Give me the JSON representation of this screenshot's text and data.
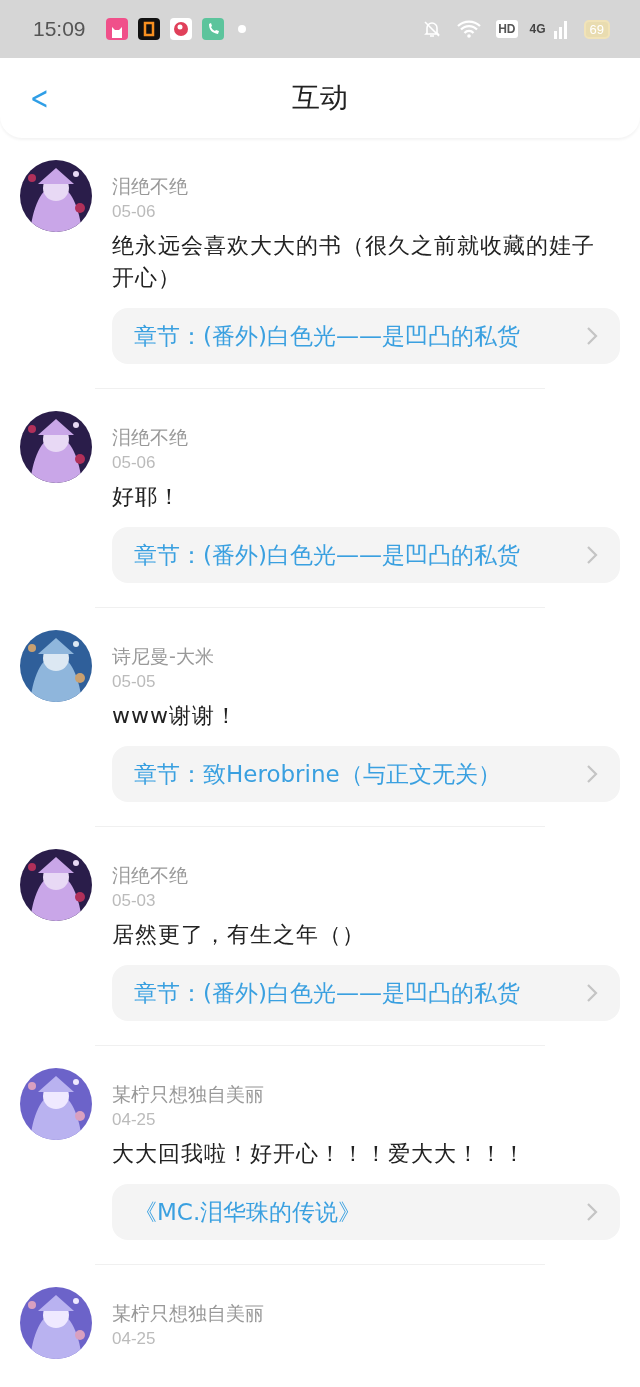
{
  "status_bar": {
    "time": "15:09",
    "network": "4G",
    "hd": "HD",
    "battery": "69"
  },
  "header": {
    "back": "<",
    "title": "互动"
  },
  "comments": [
    {
      "name": "泪绝不绝",
      "date": "05-06",
      "text": "绝永远会喜欢大大的书（很久之前就收藏的娃子开心）",
      "chapter": "章节：(番外)白色光——是凹凸的私货"
    },
    {
      "name": "泪绝不绝",
      "date": "05-06",
      "text": "好耶！",
      "chapter": "章节：(番外)白色光——是凹凸的私货"
    },
    {
      "name": "诗尼曼-大米",
      "date": "05-05",
      "text": "www谢谢！",
      "chapter": "章节：致Herobrine（与正文无关）"
    },
    {
      "name": "泪绝不绝",
      "date": "05-03",
      "text": "居然更了，有生之年（）",
      "chapter": "章节：(番外)白色光——是凹凸的私货"
    },
    {
      "name": "某柠只想独自美丽",
      "date": "04-25",
      "text": "大大回我啦！好开心！！！爱大大！！！",
      "chapter": "《MC.泪华珠的传说》"
    },
    {
      "name": "某柠只想独自美丽",
      "date": "04-25"
    }
  ]
}
